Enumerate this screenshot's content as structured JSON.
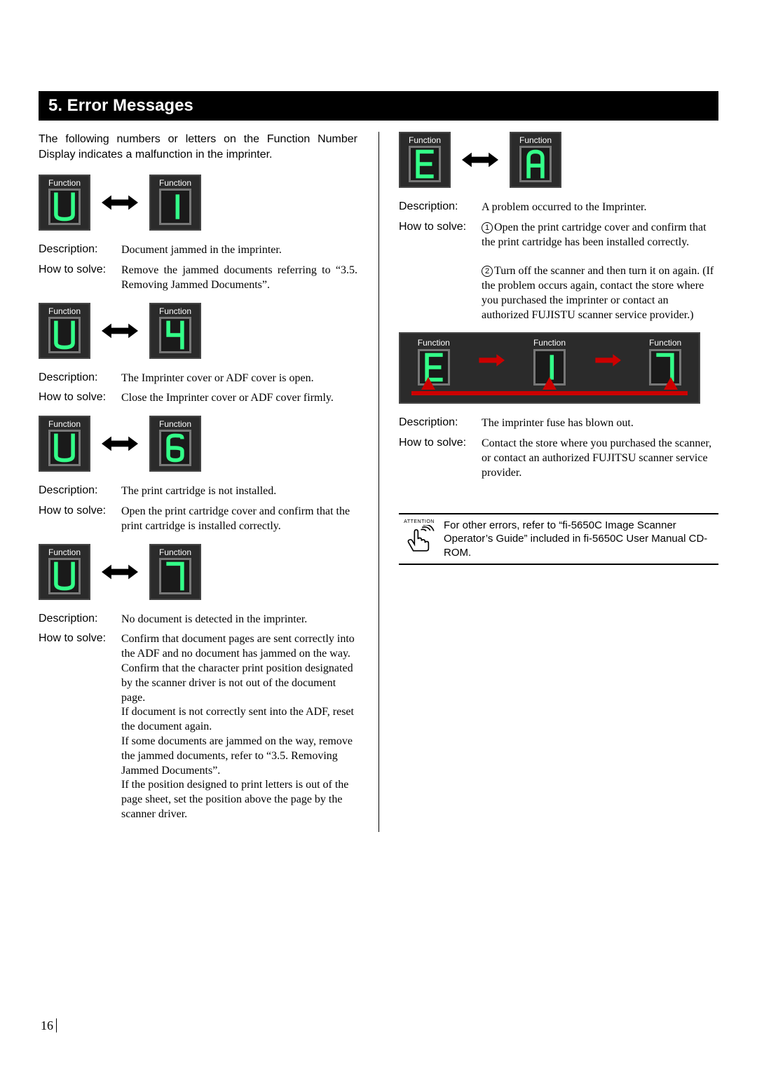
{
  "header": "5. Error Messages",
  "intro": "The following numbers or letters on the Function Number Display indicates a malfunction in the imprinter.",
  "labels": {
    "function": "Function",
    "description": "Description:",
    "how_to_solve": "How to solve:"
  },
  "left": [
    {
      "codes": [
        "U",
        "1"
      ],
      "description": "Document jammed in the imprinter.",
      "solve": "Remove the jammed documents referring to “3.5. Removing Jammed Documents”."
    },
    {
      "codes": [
        "U",
        "4"
      ],
      "description": "The Imprinter cover or ADF cover is open.",
      "solve": "Close the Imprinter cover or ADF cover firmly."
    },
    {
      "codes": [
        "U",
        "6"
      ],
      "description": "The print cartridge is not installed.",
      "solve": "Open the print cartridge cover and confirm that the print cartridge is installed correctly."
    },
    {
      "codes": [
        "U",
        "7"
      ],
      "description": "No document is detected in the imprinter.",
      "solve": "Confirm that document pages are sent correctly into the ADF and no document has jammed on the way.\nConfirm that the character print position designated by the scanner driver is not out of the document page.\nIf document is not correctly sent into the ADF, reset the document again.\nIf some documents are jammed on the way, remove the jammed documents, refer to “3.5. Removing Jammed Documents”.\nIf the position designed to print letters is out of the page sheet, set the position above the page by the scanner driver."
    }
  ],
  "right_ea": {
    "codes": [
      "E",
      "A"
    ],
    "description": "A problem occurred to the Imprinter.",
    "solve1": "Open the print cartridge cover and confirm that the print cartridge has been installed correctly.",
    "solve2": "Turn off the scanner and then turn it on again. (If the problem occurs again, contact the store where you purchased the imprinter or contact an authorized FUJISTU scanner service provider.)"
  },
  "right_seq": {
    "codes": [
      "E",
      "1",
      "7"
    ],
    "description": "The imprinter fuse has blown out.",
    "solve": "Contact the store where you purchased the scanner, or contact an authorized FUJITSU scanner service provider."
  },
  "attention_label": "ATTENTION",
  "attention": "For other errors, refer to “fi-5650C Image Scanner Operator’s Guide” included in fi-5650C User Manual CD-ROM.",
  "page_number": "16"
}
